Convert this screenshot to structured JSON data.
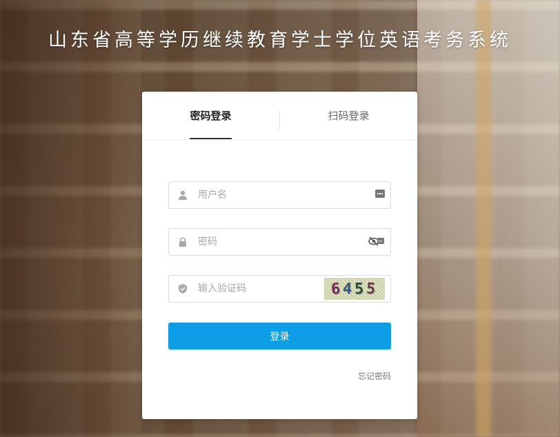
{
  "page_title": "山东省高等学历继续教育学士学位英语考务系统",
  "tabs": [
    {
      "label": "密码登录",
      "active": true
    },
    {
      "label": "扫码登录",
      "active": false
    }
  ],
  "form": {
    "username_placeholder": "用户名",
    "password_placeholder": "密码",
    "captcha_placeholder": "输入验证码",
    "captcha_digits": [
      "6",
      "4",
      "5",
      "5"
    ],
    "captcha_colors": [
      "#7a2d5a",
      "#3a5a7a",
      "#2a4a3a",
      "#6a3a4a"
    ],
    "login_label": "登录",
    "forgot_label": "忘记密码"
  },
  "colors": {
    "accent": "#0e9ee8",
    "tab_active": "#222222",
    "tab_inactive": "#666666"
  },
  "icons": {
    "username": "user-icon",
    "password": "lock-icon",
    "captcha": "shield-icon",
    "keyboard": "keyboard-icon",
    "toggle_password": "eye-slash-icon"
  }
}
